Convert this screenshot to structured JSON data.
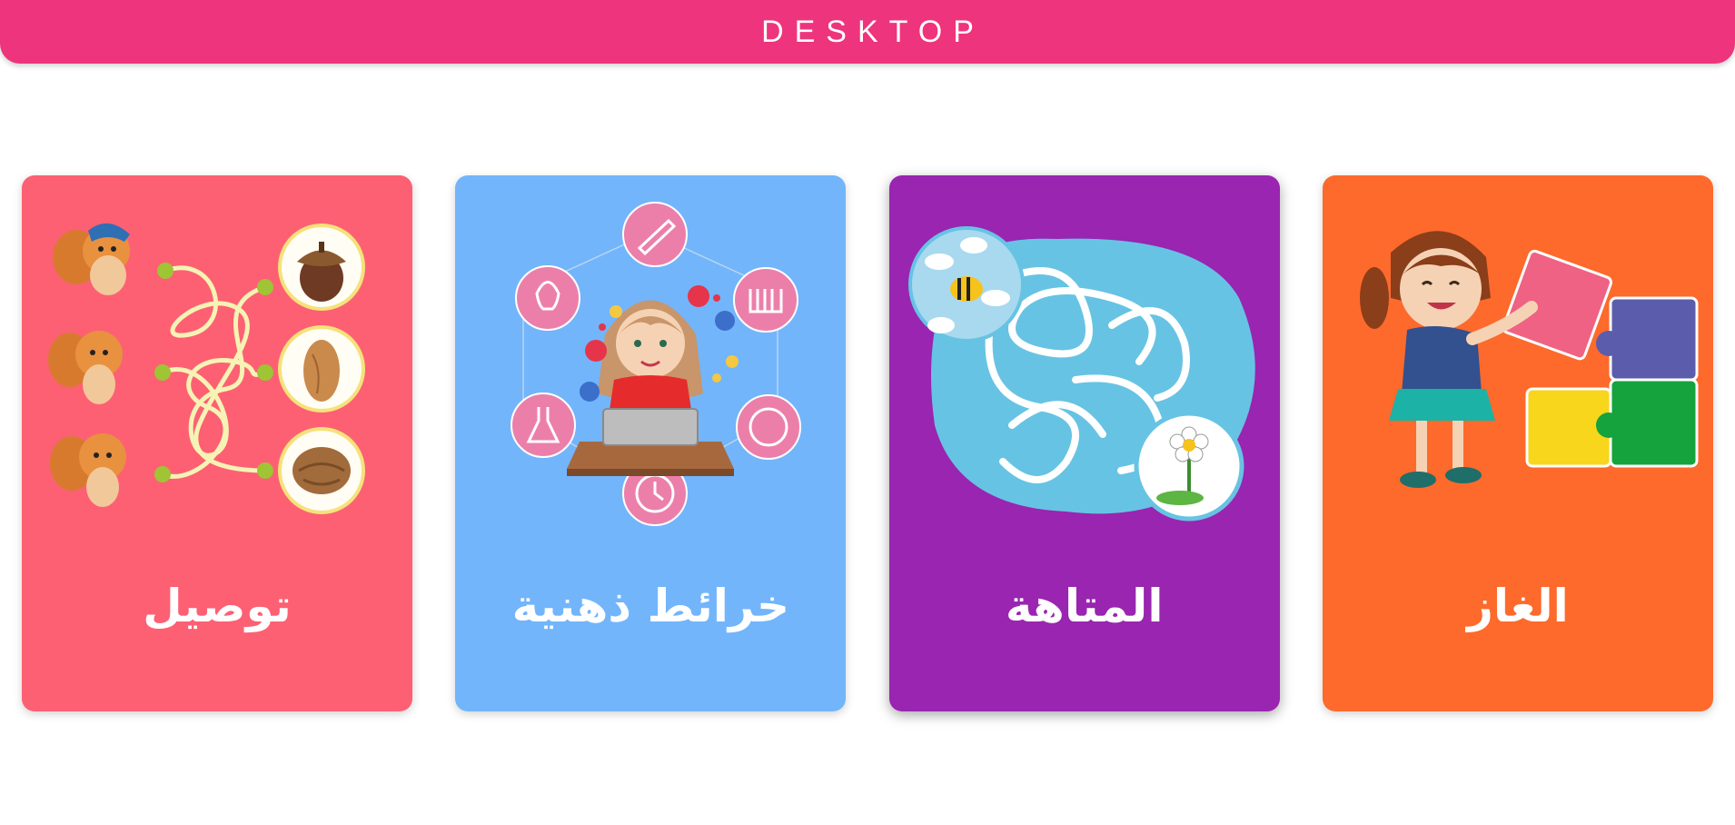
{
  "header": {
    "title": "DESKTOP",
    "color": "#ee347c"
  },
  "cards": [
    {
      "label": "توصيل",
      "color": "#fd6073",
      "illustration": "squirrels-nuts-matching-lines"
    },
    {
      "label": "خرائط ذهنية",
      "color": "#72b5fb",
      "illustration": "girl-laptop-mind-map"
    },
    {
      "label": "المتاهة",
      "color": "#9925b1",
      "illustration": "bee-flower-maze"
    },
    {
      "label": "الغاز",
      "color": "#fd6a2c",
      "illustration": "girl-jigsaw-puzzle"
    }
  ]
}
